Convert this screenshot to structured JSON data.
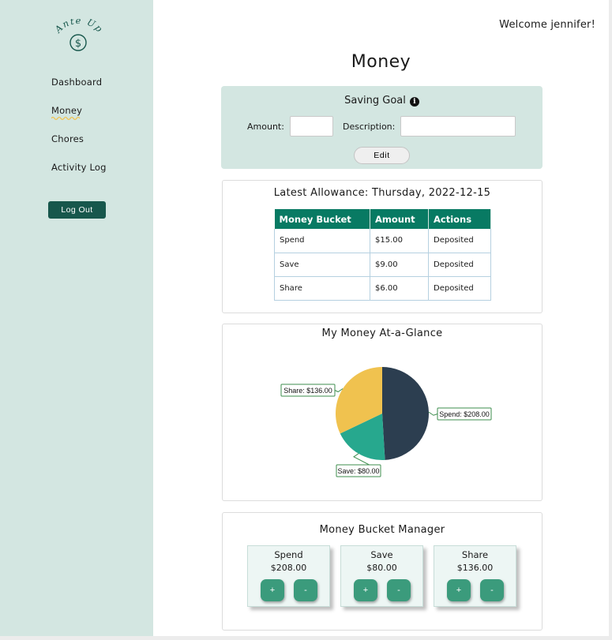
{
  "sidebar": {
    "logo_text": "Ante Up",
    "nav": [
      {
        "label": "Dashboard"
      },
      {
        "label": "Money"
      },
      {
        "label": "Chores"
      },
      {
        "label": "Activity Log"
      }
    ],
    "logout_label": "Log Out",
    "active_underline_color": "#f0c24f"
  },
  "header": {
    "welcome": "Welcome jennifer!"
  },
  "page_title": "Money",
  "saving_goal": {
    "title": "Saving Goal",
    "info_icon": "info-icon",
    "amount_label": "Amount:",
    "amount_value": "",
    "description_label": "Description:",
    "description_value": "",
    "edit_label": "Edit"
  },
  "allowance": {
    "title": "Latest Allowance: Thursday, 2022-12-15",
    "columns": [
      "Money Bucket",
      "Amount",
      "Actions"
    ],
    "rows": [
      [
        "Spend",
        "$15.00",
        "Deposited"
      ],
      [
        "Save",
        "$9.00",
        "Deposited"
      ],
      [
        "Share",
        "$6.00",
        "Deposited"
      ]
    ]
  },
  "glance": {
    "title": "My Money At-a-Glance",
    "slice_labels": {
      "spend": "Spend: $208.00",
      "save": "Save: $80.00",
      "share": "Share: $136.00"
    }
  },
  "chart_data": {
    "type": "pie",
    "title": "My Money At-a-Glance",
    "categories": [
      "Spend",
      "Save",
      "Share"
    ],
    "values": [
      208,
      80,
      136
    ],
    "colors": [
      "#2c3e50",
      "#27a88e",
      "#f0c24f"
    ],
    "labels": [
      "Spend: $208.00",
      "Save: $80.00",
      "Share: $136.00"
    ]
  },
  "bucket_manager": {
    "title": "Money Bucket Manager",
    "buckets": [
      {
        "name": "Spend",
        "amount": "$208.00",
        "plus": "+",
        "minus": "-"
      },
      {
        "name": "Save",
        "amount": "$80.00",
        "plus": "+",
        "minus": "-"
      },
      {
        "name": "Share",
        "amount": "$136.00",
        "plus": "+",
        "minus": "-"
      }
    ]
  },
  "colors": {
    "sidebar_bg": "#d3e6e1",
    "accent_dark": "#17574c",
    "table_header": "#087a63",
    "bucket_button": "#3b9b7c"
  }
}
